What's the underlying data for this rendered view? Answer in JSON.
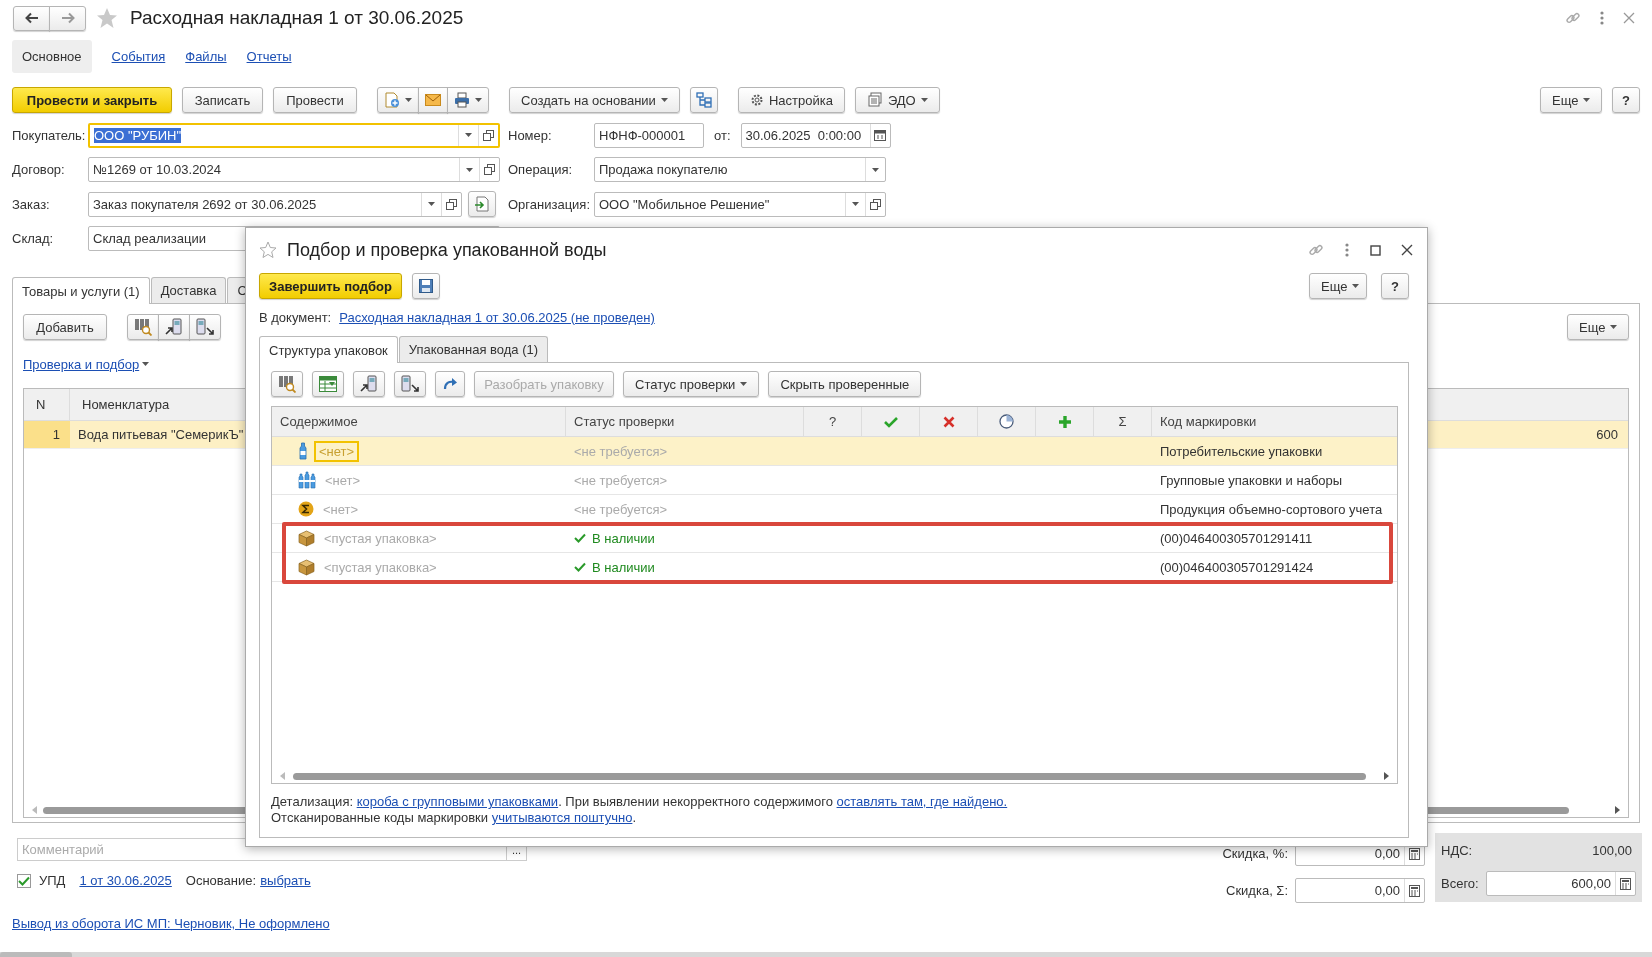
{
  "header": {
    "title": "Расходная накладная 1 от 30.06.2025"
  },
  "section_tabs": [
    {
      "label": "Основное",
      "selected": true
    },
    {
      "label": "События",
      "selected": false
    },
    {
      "label": "Файлы",
      "selected": false
    },
    {
      "label": "Отчеты",
      "selected": false
    }
  ],
  "toolbar": {
    "post_close": "Провести и закрыть",
    "save": "Записать",
    "post": "Провести",
    "create_based": "Создать на основании",
    "settings": "Настройка",
    "edo": "ЭДО",
    "more": "Еще",
    "help": "?"
  },
  "fields_left": [
    {
      "label": "Покупатель:",
      "value": "ООО \"РУБИН\"",
      "focused": true,
      "kind": "select"
    },
    {
      "label": "Договор:",
      "value": "№1269 от 10.03.2024",
      "focused": false,
      "kind": "select"
    },
    {
      "label": "Заказ:",
      "value": "Заказ покупателя 2692 от 30.06.2025",
      "focused": false,
      "kind": "select-fill"
    },
    {
      "label": "Склад:",
      "value": "Склад реализации",
      "focused": false,
      "kind": "plain"
    }
  ],
  "fields_right": [
    {
      "label": "Номер:",
      "kind": "number-date",
      "value": "НФНФ-000001",
      "date_label": "от:",
      "date_value": "30.06.2025  0:00:00"
    },
    {
      "label": "Операция:",
      "kind": "list",
      "value": "Продажа покупателю"
    },
    {
      "label": "Организация:",
      "kind": "select",
      "value": "ООО \"Мобильное Решение\""
    }
  ],
  "goods": {
    "tabs": [
      {
        "label": "Товары и услуги (1)",
        "selected": true
      },
      {
        "label": "Доставка",
        "selected": false
      },
      {
        "label": "С",
        "selected": false
      }
    ],
    "add": "Добавить",
    "check_link": "Проверка и подбор",
    "more": "Еще",
    "columns": [
      "N",
      "Номенклатура"
    ],
    "rows": [
      {
        "n": "1",
        "name": "Вода питьевая \"СемерикЪ\"",
        "column_last": "600",
        "selected": true
      }
    ]
  },
  "dialog": {
    "title": "Подбор и проверка упакованной воды",
    "finish": "Завершить подбор",
    "more": "Еще",
    "help": "?",
    "doc_label": "В документ:",
    "doc_link": "Расходная накладная 1 от 30.06.2025 (не проведен)",
    "tabs": [
      {
        "label": "Структура упаковок",
        "selected": true
      },
      {
        "label": "Упакованная вода (1)",
        "selected": false
      }
    ],
    "toolbar": {
      "unpack": {
        "label": "Разобрать упаковку",
        "disabled": true
      },
      "status": "Статус проверки",
      "hide_checked": "Скрыть проверенные"
    },
    "columns": [
      {
        "kind": "text",
        "label": "Содержимое"
      },
      {
        "kind": "text",
        "label": "Статус проверки"
      },
      {
        "kind": "text",
        "label": "?"
      },
      {
        "kind": "check"
      },
      {
        "kind": "cross"
      },
      {
        "kind": "clock"
      },
      {
        "kind": "plus"
      },
      {
        "kind": "text",
        "label": "Σ"
      },
      {
        "kind": "text",
        "label": "Код маркировки"
      }
    ],
    "rows": [
      {
        "kind": "bottle",
        "content": "<нет>",
        "status": "<не требуется>",
        "checked": false,
        "code": "Потребительские упаковки",
        "selected": true,
        "highlighted": false
      },
      {
        "kind": "bottles",
        "content": "<нет>",
        "status": "<не требуется>",
        "checked": false,
        "code": "Групповые упаковки и наборы",
        "selected": false,
        "highlighted": false
      },
      {
        "kind": "sigma",
        "content": "<нет>",
        "status": "<не требуется>",
        "checked": false,
        "code": "Продукция объемно-сортового учета",
        "selected": false,
        "highlighted": false
      },
      {
        "kind": "box",
        "content": "<пустая упаковка>",
        "status": "В наличии",
        "checked": true,
        "code": "(00)046400305701291411",
        "selected": false,
        "highlighted": true
      },
      {
        "kind": "box",
        "content": "<пустая упаковка>",
        "status": "В наличии",
        "checked": true,
        "code": "(00)046400305701291424",
        "selected": false,
        "highlighted": true
      }
    ],
    "notes": [
      [
        {
          "kind": "text",
          "text": "Детализация: "
        },
        {
          "kind": "link",
          "text": "короба с групповыми упаковками"
        },
        {
          "kind": "text",
          "text": ". При выявлении некорректного содержимого "
        },
        {
          "kind": "link",
          "text": "оставлять там, где найдено."
        }
      ],
      [
        {
          "kind": "text",
          "text": "Отсканированные коды маркировки "
        },
        {
          "kind": "link",
          "text": "учитываются поштучно"
        },
        {
          "kind": "text",
          "text": "."
        }
      ]
    ]
  },
  "footer": {
    "comment_placeholder": "Комментарий",
    "comment_button": "...",
    "upd": {
      "checked": true,
      "label": "УПД",
      "link": "1 от 30.06.2025",
      "basis_label": "Основание:",
      "basis_link": "выбрать"
    },
    "discount_percent": {
      "label": "Скидка, %:",
      "value": "0,00"
    },
    "discount_sum": {
      "label": "Скидка, Σ:",
      "value": "0,00"
    },
    "vat": {
      "label": "НДС:",
      "value": "100,00"
    },
    "total": {
      "label": "Всего:",
      "value": "600,00"
    },
    "status_link": "Вывод из оборота ИС МП: Черновик, Не оформлено"
  }
}
